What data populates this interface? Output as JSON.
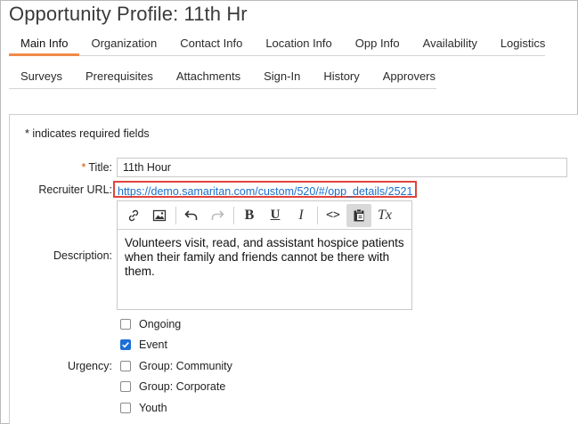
{
  "page_title": "Opportunity Profile: 11th Hr",
  "tabs_row1": [
    {
      "label": "Main Info",
      "active": true
    },
    {
      "label": "Organization",
      "active": false
    },
    {
      "label": "Contact Info",
      "active": false
    },
    {
      "label": "Location Info",
      "active": false
    },
    {
      "label": "Opp Info",
      "active": false
    },
    {
      "label": "Availability",
      "active": false
    },
    {
      "label": "Logistics",
      "active": false
    }
  ],
  "tabs_row2": [
    {
      "label": "Surveys"
    },
    {
      "label": "Prerequisites"
    },
    {
      "label": "Attachments"
    },
    {
      "label": "Sign-In"
    },
    {
      "label": "History"
    },
    {
      "label": "Approvers"
    }
  ],
  "form": {
    "required_note": "* indicates required fields",
    "title_required_marker": "*",
    "title_label": "Title:",
    "title_value": "11th Hour",
    "recruiter_url_label": "Recruiter URL:",
    "recruiter_url": "https://demo.samaritan.com/custom/520/#/opp_details/2521",
    "description_label": "Description:",
    "description_text": "Volunteers visit, read, and assistant hospice patients when their family and friends cannot be there with them.",
    "urgency_label": "Urgency:",
    "urgency_options": [
      {
        "label": "Ongoing",
        "checked": false
      },
      {
        "label": "Event",
        "checked": true
      },
      {
        "label": "Group: Community",
        "checked": false
      },
      {
        "label": "Group: Corporate",
        "checked": false
      },
      {
        "label": "Youth",
        "checked": false
      }
    ]
  },
  "editor_toolbar": {
    "bold_glyph": "B",
    "underline_glyph": "U",
    "italic_glyph": "I",
    "code_glyph": "<>",
    "clear_format_glyph": "Tx",
    "icons": [
      "link-icon",
      "image-icon",
      "undo-icon",
      "redo-icon",
      "bold-icon",
      "underline-icon",
      "italic-icon",
      "code-view-icon",
      "paste-icon",
      "clear-format-icon"
    ]
  },
  "colors": {
    "active_tab": "#f08a4b",
    "link": "#1a6fc9",
    "highlight_border": "#e0443a",
    "checkbox_checked": "#1d6fd6",
    "required": "#d35400"
  }
}
